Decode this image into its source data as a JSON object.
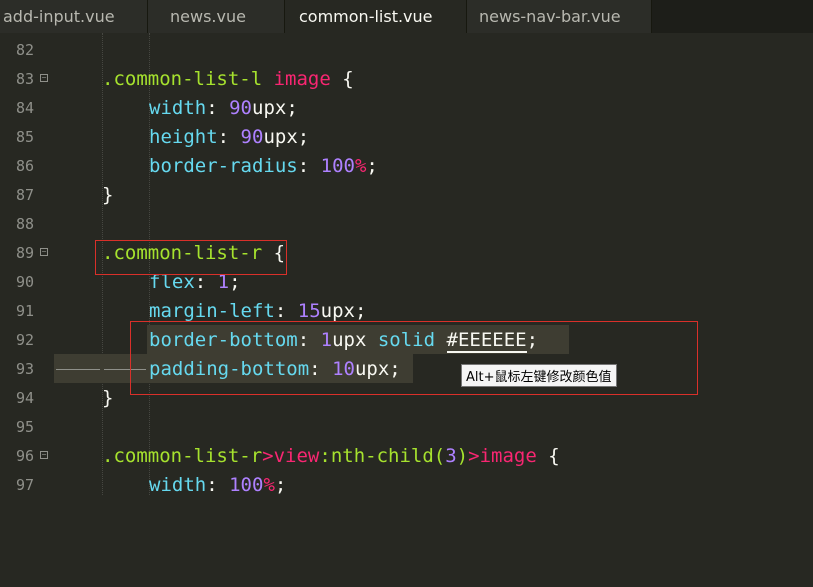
{
  "tabs": [
    {
      "label": "add-input.vue",
      "active": false
    },
    {
      "label": "news.vue",
      "active": false
    },
    {
      "label": "common-list.vue",
      "active": true
    },
    {
      "label": "news-nav-bar.vue",
      "active": false
    }
  ],
  "lines": [
    {
      "no": "82",
      "fold": false
    },
    {
      "no": "83",
      "fold": true
    },
    {
      "no": "84",
      "fold": false
    },
    {
      "no": "85",
      "fold": false
    },
    {
      "no": "86",
      "fold": false
    },
    {
      "no": "87",
      "fold": false
    },
    {
      "no": "88",
      "fold": false
    },
    {
      "no": "89",
      "fold": true
    },
    {
      "no": "90",
      "fold": false
    },
    {
      "no": "91",
      "fold": false
    },
    {
      "no": "92",
      "fold": false
    },
    {
      "no": "93",
      "fold": false
    },
    {
      "no": "94",
      "fold": false
    },
    {
      "no": "95",
      "fold": false
    },
    {
      "no": "96",
      "fold": true
    },
    {
      "no": "97",
      "fold": false
    }
  ],
  "code": {
    "l83_sel": ".common-list-l",
    "l83_tag": "image",
    "l83_brace": "{",
    "l84_prop": "width",
    "l84_colon": ":",
    "l84_num": "90",
    "l84_unit": "upx;",
    "l85_prop": "height",
    "l85_colon": ":",
    "l85_num": "90",
    "l85_unit": "upx;",
    "l86_prop": "border-radius",
    "l86_colon": ":",
    "l86_num": "100",
    "l86_unit": "%",
    "l86_end": ";",
    "l87": "}",
    "l89_sel": ".common-list-r",
    "l89_brace": "{",
    "l90_prop": "flex",
    "l90_colon": ":",
    "l90_num": "1",
    "l90_end": ";",
    "l91_prop": "margin-left",
    "l91_colon": ":",
    "l91_num": "15",
    "l91_unit": "upx;",
    "l92_prop": "border-bottom",
    "l92_colon": ":",
    "l92_num": "1",
    "l92_unit": "upx",
    "l92_solid": "solid",
    "l92_color": "#EEEEEE",
    "l92_end": ";",
    "l93_prop": "padding-bottom",
    "l93_colon": ":",
    "l93_num": "10",
    "l93_unit": "upx;",
    "l94": "}",
    "l96_sel": ".common-list-r",
    "l96_gt1": ">",
    "l96_tag1": "view",
    "l96_pseudo": ":nth-child(",
    "l96_n": "3",
    "l96_close": ")",
    "l96_gt2": ">",
    "l96_tag2": "image",
    "l96_brace": "{",
    "l97_prop": "width",
    "l97_colon": ":",
    "l97_num": "100",
    "l97_unit": "%",
    "l97_end": ";"
  },
  "tooltip": {
    "text": "Alt+鼠标左键修改颜色值"
  },
  "colors": {
    "background": "#272822",
    "selector": "#a6e22e",
    "keyword": "#f92672",
    "property": "#66d9ef",
    "number": "#ae81ff",
    "annotation": "#d9302a"
  }
}
